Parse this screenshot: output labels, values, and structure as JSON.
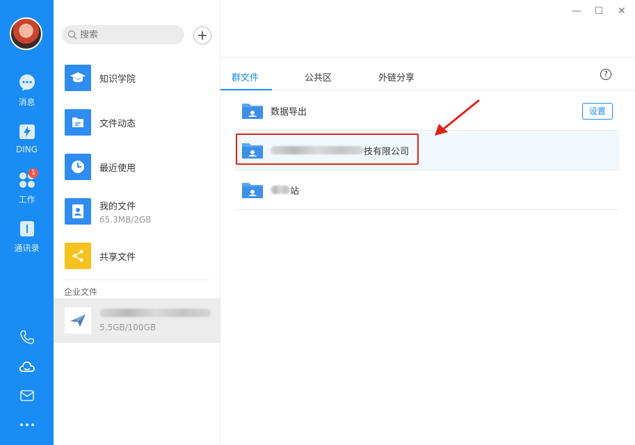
{
  "rail": {
    "items": [
      {
        "label": "消息",
        "icon": "message-icon"
      },
      {
        "label": "DING",
        "icon": "ding-icon"
      },
      {
        "label": "工作",
        "icon": "work-icon",
        "badge": "1"
      },
      {
        "label": "通讯录",
        "icon": "contacts-icon"
      }
    ],
    "bottom_icons": [
      "phone-icon",
      "cloud-icon",
      "mail-icon",
      "more-icon"
    ]
  },
  "search": {
    "placeholder": "搜索"
  },
  "nav": [
    {
      "label": "知识学院",
      "sub": "",
      "icon": "graduation-cap-icon",
      "color": "#2f8cf0"
    },
    {
      "label": "文件动态",
      "sub": "",
      "icon": "file-activity-icon",
      "color": "#2f8cf0"
    },
    {
      "label": "最近使用",
      "sub": "",
      "icon": "clock-icon",
      "color": "#2f8cf0"
    },
    {
      "label": "我的文件",
      "sub": "65.3MB/2GB",
      "icon": "user-file-icon",
      "color": "#2f8cf0"
    },
    {
      "label": "共享文件",
      "sub": "",
      "icon": "share-icon",
      "color": "#f7c21c"
    }
  ],
  "enterprise": {
    "section_label": "企业文件",
    "usage": "5.5GB/100GB"
  },
  "tabs": [
    {
      "label": "群文件",
      "active": true
    },
    {
      "label": "公共区",
      "active": false
    },
    {
      "label": "外链分享",
      "active": false
    }
  ],
  "help_label": "?",
  "files": [
    {
      "name": "数据导出",
      "selected": false,
      "has_settings": true
    },
    {
      "name": "技有限公司",
      "selected": true,
      "has_settings": false
    },
    {
      "name": "站",
      "selected": false,
      "has_settings": false
    }
  ],
  "settings_label": "设置",
  "window": {
    "minimize": "—",
    "maximize": "☐",
    "close": "✕"
  },
  "colors": {
    "brand": "#1a8cf5",
    "highlight": "#e0231b",
    "badge": "#f25643"
  }
}
